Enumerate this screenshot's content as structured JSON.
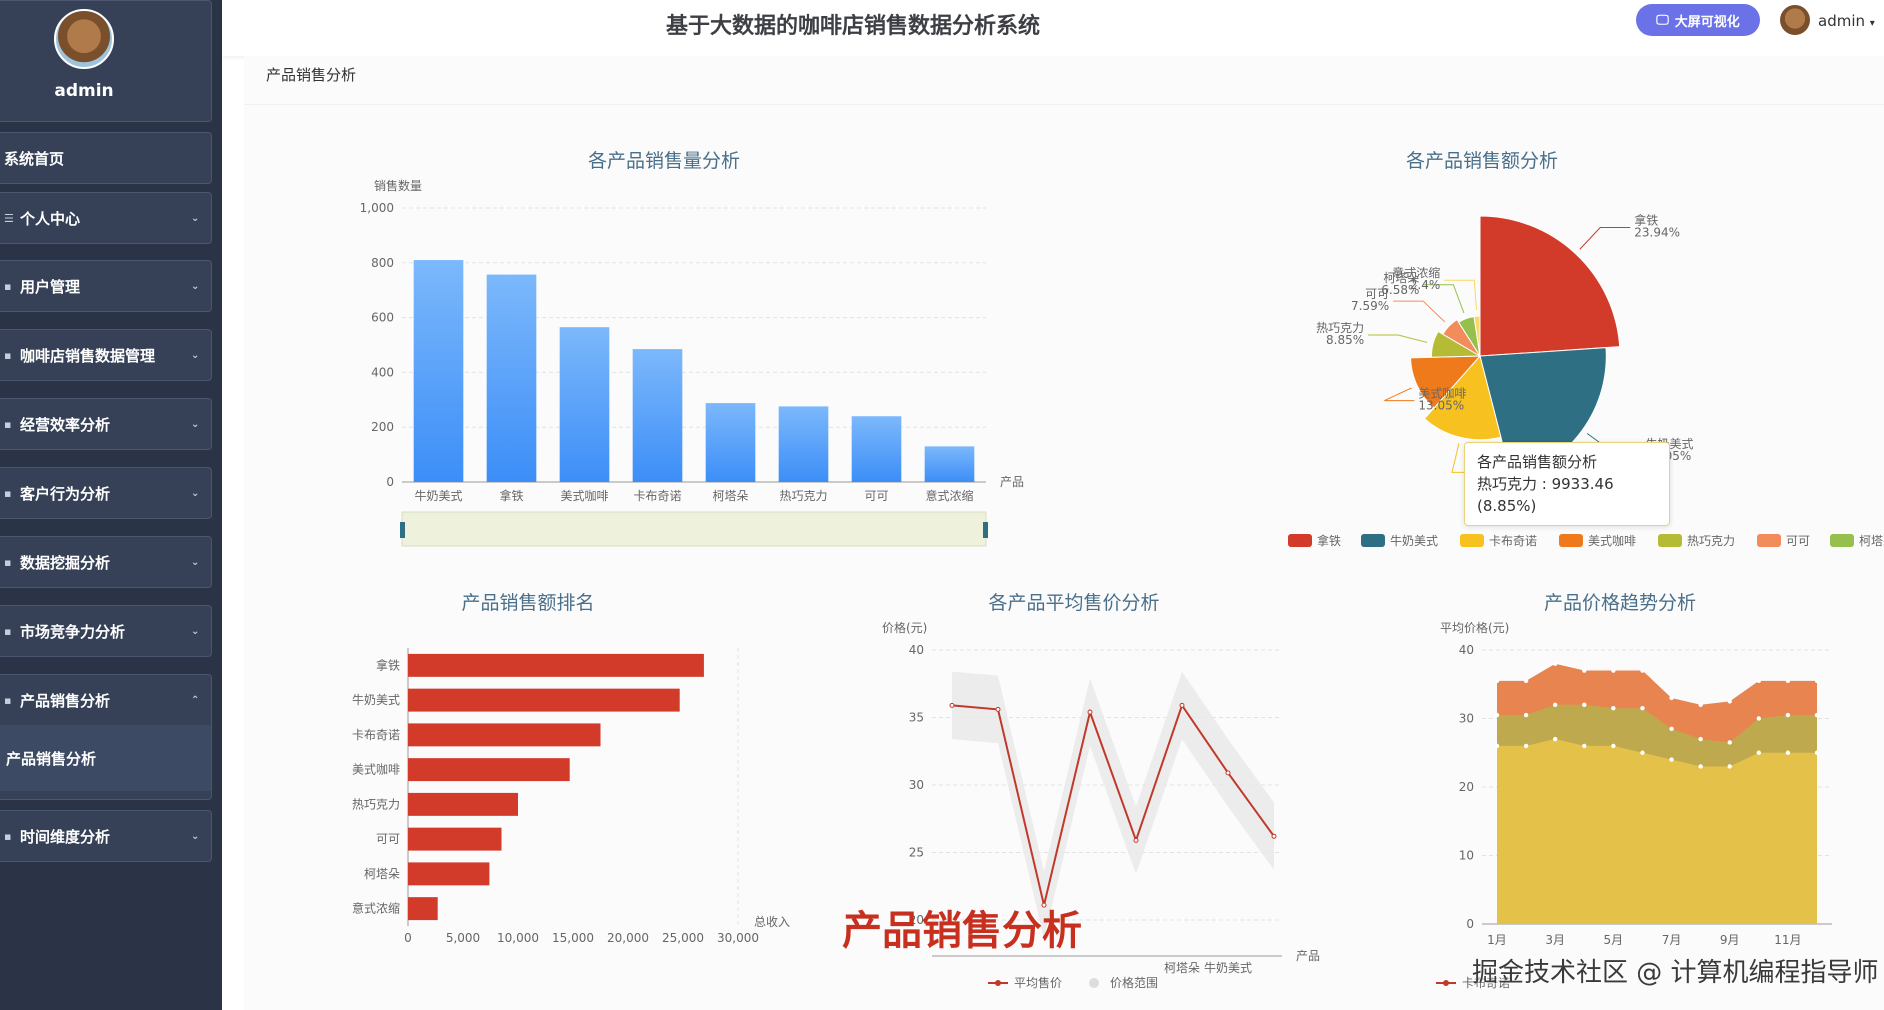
{
  "app": {
    "title": "基于大数据的咖啡店销售数据分析系统",
    "bigscreen_label": "大屏可视化",
    "user": "admin"
  },
  "sidebar": {
    "user": "admin",
    "items": [
      {
        "label": "系统首页"
      },
      {
        "label": "个人中心"
      },
      {
        "label": "用户管理"
      },
      {
        "label": "咖啡店销售数据管理"
      },
      {
        "label": "经营效率分析"
      },
      {
        "label": "客户行为分析"
      },
      {
        "label": "数据挖掘分析"
      },
      {
        "label": "市场竞争力分析"
      },
      {
        "label": "产品销售分析"
      },
      {
        "label": "产品销售分析"
      },
      {
        "label": "时间维度分析"
      }
    ]
  },
  "breadcrumb": "产品销售分析",
  "overlay_title": "产品销售分析",
  "watermark": "掘金技术社区 @ 计算机编程指导师",
  "colors": {
    "bar_blue": "#3c8ef8",
    "bar_red": "#d23a2a",
    "accent": "#6b72e8"
  },
  "chart_data": [
    {
      "type": "bar",
      "title": "各产品销售量分析",
      "ylabel": "销售数量",
      "xlabel": "产品",
      "categories": [
        "牛奶美式",
        "拿铁",
        "美式咖啡",
        "卡布奇诺",
        "柯塔朵",
        "热巧克力",
        "可可",
        "意式浓缩"
      ],
      "values": [
        810,
        757,
        565,
        485,
        288,
        276,
        240,
        130
      ],
      "ylim": [
        0,
        1000
      ],
      "yticks": [
        "0",
        "200",
        "400",
        "600",
        "800",
        "1,000"
      ],
      "grid": true
    },
    {
      "type": "pie",
      "title": "各产品销售额分析",
      "slices": [
        {
          "name": "拿铁",
          "pct": "23.94%",
          "value": 23.94,
          "color": "#d23a2a"
        },
        {
          "name": "牛奶美式",
          "pct": "22.05%",
          "value": 22.05,
          "color": "#2e6f84"
        },
        {
          "name": "卡布奇诺",
          "pct": "15.54%",
          "value": 15.54,
          "color": "#f7c11f"
        },
        {
          "name": "美式咖啡",
          "pct": "13.05%",
          "value": 13.05,
          "color": "#ee7a1c"
        },
        {
          "name": "热巧克力",
          "pct": "8.85%",
          "value": 8.85,
          "color": "#b5bb35"
        },
        {
          "name": "可可",
          "pct": "7.59%",
          "value": 7.59,
          "color": "#f28c5a"
        },
        {
          "name": "柯塔朵",
          "pct": "6.58%",
          "value": 6.58,
          "color": "#96c04e"
        },
        {
          "name": "意式浓缩",
          "pct": "2.4%",
          "value": 2.4,
          "color": "#fbd765"
        }
      ],
      "legend": "bottom",
      "tooltip": {
        "title": "各产品销售额分析",
        "line": "热巧克力 : 9933.46 (8.85%)"
      }
    },
    {
      "type": "bar",
      "orientation": "horizontal",
      "title": "产品销售额排名",
      "xlabel": "总收入",
      "categories": [
        "拿铁",
        "牛奶美式",
        "卡布奇诺",
        "美式咖啡",
        "热巧克力",
        "可可",
        "柯塔朵",
        "意式浓缩"
      ],
      "values": [
        26900,
        24700,
        17500,
        14700,
        10000,
        8500,
        7400,
        2700
      ],
      "xlim": [
        0,
        30000
      ],
      "xticks": [
        "0",
        "5,000",
        "10,000",
        "15,000",
        "20,000",
        "25,000",
        "30,000"
      ]
    },
    {
      "type": "line",
      "title": "各产品平均售价分析",
      "ylabel": "价格(元)",
      "xlabel": "产品",
      "categories": [
        "",
        "",
        "",
        "",
        "",
        "柯塔朵",
        "牛奶美式",
        ""
      ],
      "values": [
        35.9,
        35.6,
        21.1,
        35.4,
        25.9,
        35.9,
        30.9,
        26.2
      ],
      "ylim": [
        20,
        40
      ],
      "yticks": [
        "20",
        "25",
        "30",
        "35",
        "40"
      ],
      "legend": [
        {
          "name": "平均售价"
        },
        {
          "name": "价格范围"
        }
      ]
    },
    {
      "type": "area",
      "title": "产品价格趋势分析",
      "ylabel": "平均价格(元)",
      "x": [
        "1月",
        "2月",
        "3月",
        "4月",
        "5月",
        "6月",
        "7月",
        "8月",
        "9月",
        "10月",
        "11月",
        "12月"
      ],
      "xticks": [
        "1月",
        "3月",
        "5月",
        "7月",
        "9月",
        "11月"
      ],
      "ylim": [
        0,
        40
      ],
      "yticks": [
        "0",
        "10",
        "20",
        "30",
        "40"
      ],
      "series": [
        {
          "values": [
            26,
            26,
            27,
            26,
            26,
            25,
            24,
            23,
            23,
            25,
            25,
            25
          ],
          "color": "#e4c24a"
        },
        {
          "values": [
            30.5,
            30.5,
            32,
            32,
            31.5,
            31.5,
            28.5,
            27,
            26.5,
            30,
            30.5,
            30.5
          ],
          "color": "#bfa94f"
        },
        {
          "values": [
            35.5,
            35.5,
            38,
            37,
            37,
            37,
            33,
            32,
            32.5,
            35.5,
            35.5,
            35.5
          ],
          "color": "#e88450"
        }
      ],
      "legend": [
        {
          "name": "卡布奇诺"
        }
      ]
    }
  ]
}
